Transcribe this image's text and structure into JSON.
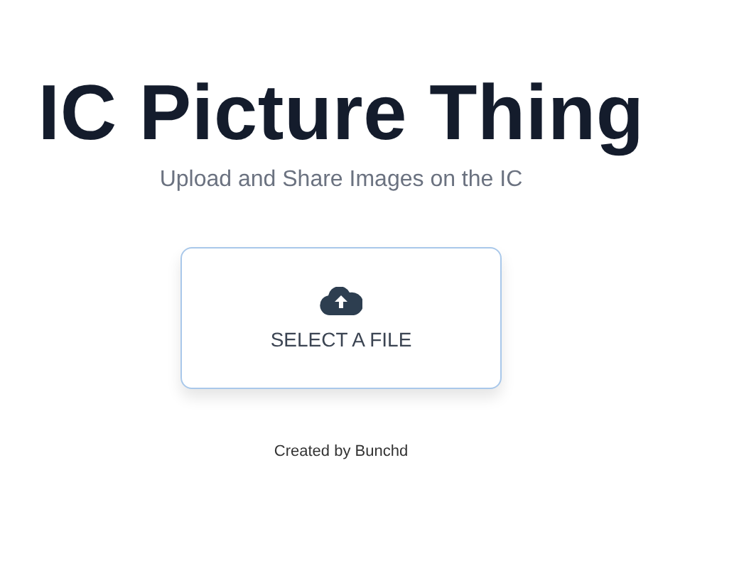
{
  "header": {
    "title": "IC Picture Thing",
    "subtitle": "Upload and Share Images on the IC"
  },
  "upload": {
    "label": "SELECT A FILE"
  },
  "footer": {
    "credit": "Created by Bunchd"
  }
}
